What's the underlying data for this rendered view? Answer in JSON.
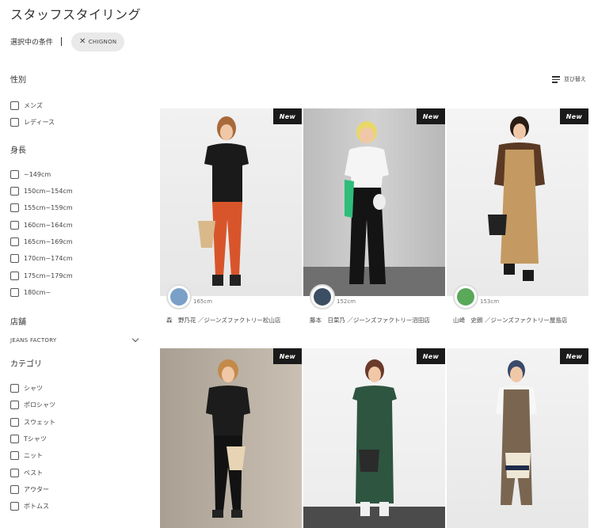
{
  "page": {
    "title": "スタッフスタイリング"
  },
  "conditions": {
    "label": "選択中の条件",
    "chip": "CHIGNON"
  },
  "sort": {
    "label": "並び替え"
  },
  "filters": {
    "gender": {
      "title": "性別",
      "options": [
        "メンズ",
        "レディース"
      ]
    },
    "height": {
      "title": "身長",
      "options": [
        "~149cm",
        "150cm~154cm",
        "155cm~159cm",
        "160cm~164cm",
        "165cm~169cm",
        "170cm~174cm",
        "175cm~179cm",
        "180cm~"
      ]
    },
    "store": {
      "title": "店舗",
      "selected": "JEANS FACTORY"
    },
    "category": {
      "title": "カテゴリ",
      "options": [
        "シャツ",
        "ポロシャツ",
        "スウェット",
        "Tシャツ",
        "ニット",
        "ベスト",
        "アウター",
        "ボトムス"
      ]
    }
  },
  "cards": [
    {
      "badge": "New",
      "height": "165cm",
      "staff": "森　野乃花 ／ジーンズファクトリー松山店"
    },
    {
      "badge": "New",
      "height": "152cm",
      "staff": "藤本　日菜乃 ／ジーンズファクトリー沼田店"
    },
    {
      "badge": "New",
      "height": "153cm",
      "staff": "山崎　史朗 ／ジーンズファクトリー屋島店"
    },
    {
      "badge": "New"
    },
    {
      "badge": "New"
    },
    {
      "badge": "New"
    }
  ]
}
